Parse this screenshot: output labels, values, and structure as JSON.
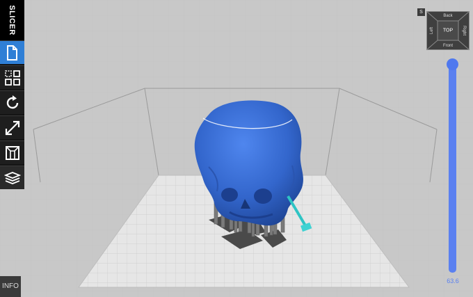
{
  "toolbar": {
    "title": "SLICER",
    "tools": [
      {
        "name": "new-file",
        "icon": "document-icon",
        "active": true
      },
      {
        "name": "arrange",
        "icon": "grid-layout-icon",
        "active": false
      },
      {
        "name": "rotate",
        "icon": "rotate-icon",
        "active": false
      },
      {
        "name": "scale",
        "icon": "resize-arrow-icon",
        "active": false
      },
      {
        "name": "supports",
        "icon": "support-structure-icon",
        "active": false
      },
      {
        "name": "layers",
        "icon": "layers-icon",
        "active": true
      }
    ],
    "info_label": "INFO"
  },
  "view_cube": {
    "settings_label": "S",
    "top": "TOP",
    "back": "Back",
    "front": "Front",
    "left": "Left",
    "right": "Right"
  },
  "layer_slider": {
    "value": "63.6",
    "level": 1.0,
    "color": "#5a80f0"
  },
  "model": {
    "color": "#3b6fd6",
    "support_color": "#6e6e6e",
    "selected_support_color": "#2ec4c4"
  },
  "colors": {
    "accent": "#2f7fd6",
    "background": "#c8c8c8",
    "build_plate": "#e6e6e6"
  }
}
